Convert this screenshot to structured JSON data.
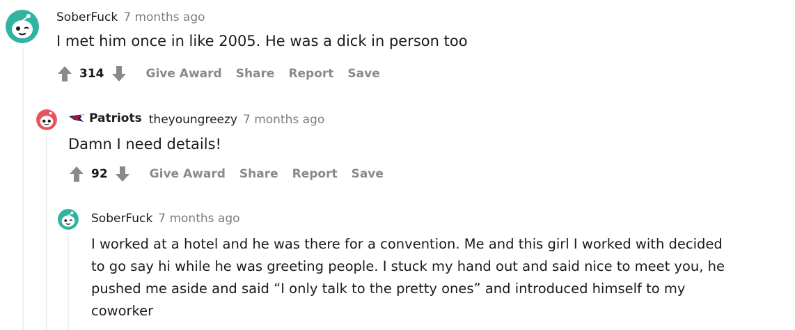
{
  "comments": [
    {
      "author": "SoberFuck",
      "time": "7 months ago",
      "body": "I met him once in like 2005. He was a dick in person too",
      "score": "314",
      "actions": {
        "award": "Give Award",
        "share": "Share",
        "report": "Report",
        "save": "Save"
      },
      "avatar_color": "#2fb3a3"
    },
    {
      "flair": "Patriots",
      "author": "theyoungreezy",
      "time": "7 months ago",
      "body": "Damn I need details!",
      "score": "92",
      "actions": {
        "award": "Give Award",
        "share": "Share",
        "report": "Report",
        "save": "Save"
      },
      "avatar_color": "#e8545c"
    },
    {
      "author": "SoberFuck",
      "time": "7 months ago",
      "body_lines": [
        "I worked at a hotel and he was there for a convention. Me and this girl I worked with decided",
        "to go say hi while he was greeting people. I stuck my hand out and said nice to meet you, he",
        "pushed me aside and said “I only talk to the pretty ones” and introduced himself to my",
        "coworker"
      ],
      "avatar_color": "#2fb3a3"
    }
  ],
  "colors": {
    "thread_line": "#edeff1",
    "meta_gray": "#7c7c7c",
    "action_gray": "#878a8c"
  },
  "icons": [
    "snoo-avatar-icon",
    "upvote-arrow-icon",
    "downvote-arrow-icon",
    "patriots-flair-icon"
  ]
}
